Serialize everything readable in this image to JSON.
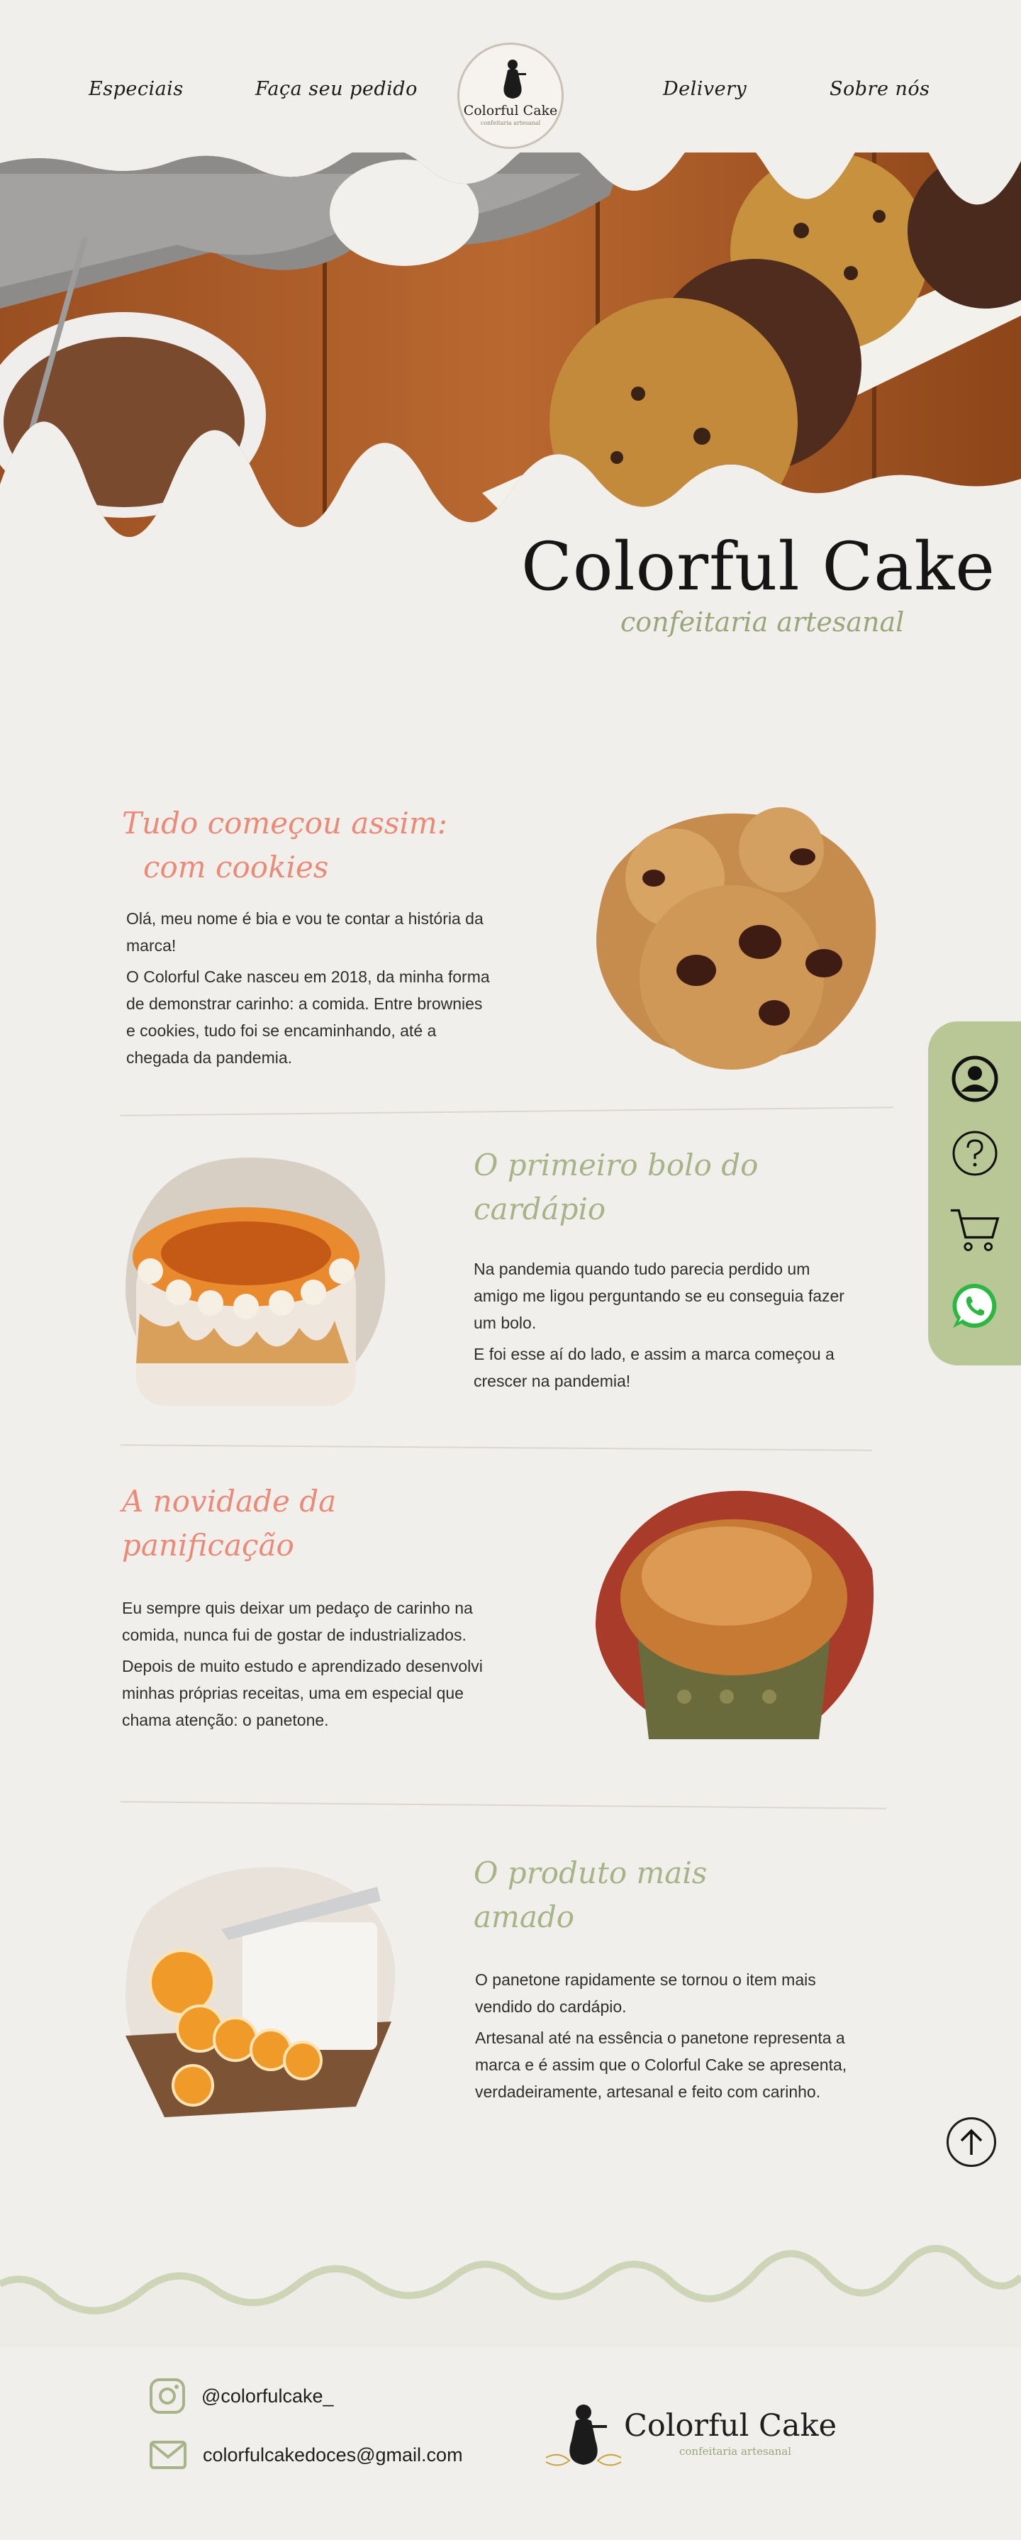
{
  "nav": {
    "items": [
      "Especiais",
      "Faça seu pedido",
      "Delivery",
      "Sobre nós"
    ],
    "logo_text": "Colorful Cake",
    "logo_sub": "confeitaria artesanal"
  },
  "hero": {
    "title": "Colorful Cake",
    "subtitle": "confeitaria artesanal"
  },
  "sections": [
    {
      "title_lines": [
        "Tudo começou assim:",
        "com cookies"
      ],
      "paragraphs": [
        "Olá, meu nome é bia e vou te contar a história da marca!",
        "O Colorful Cake nasceu em 2018, da minha forma de demonstrar carinho: a comida. Entre brownies e cookies, tudo foi se encaminhando, até a chegada da pandemia."
      ]
    },
    {
      "title_lines": [
        "O primeiro bolo do",
        "cardápio"
      ],
      "paragraphs": [
        "Na pandemia quando tudo parecia perdido um amigo me ligou perguntando se eu conseguia fazer um bolo.",
        "E foi esse aí do lado, e assim a marca começou a crescer na pandemia!"
      ]
    },
    {
      "title_lines": [
        "A novidade da",
        "panificação"
      ],
      "paragraphs": [
        "Eu sempre quis deixar um pedaço de carinho na comida, nunca fui de gostar de industrializados.",
        "Depois de muito estudo e aprendizado desenvolvi minhas próprias receitas, uma em especial que chama atenção: o panetone."
      ]
    },
    {
      "title_lines": [
        "O produto mais",
        "amado"
      ],
      "paragraphs": [
        "O panetone rapidamente se tornou o item mais vendido do cardápio.",
        "Artesanal até na essência o panetone representa a marca e é assim que o Colorful Cake se apresenta, verdadeiramente, artesanal e feito com carinho."
      ]
    }
  ],
  "side_menu": {
    "icons": [
      "user-icon",
      "help-icon",
      "cart-icon",
      "whatsapp-icon"
    ],
    "bg_color": "#b9c796"
  },
  "footer": {
    "instagram": "@colorfulcake_",
    "email": "colorfulcakedoces@gmail.com",
    "logo_text": "Colorful Cake",
    "logo_sub": "confeitaria artesanal"
  },
  "colors": {
    "salmon": "#ea8a78",
    "green": "#a6b487",
    "background": "#f1efec"
  }
}
